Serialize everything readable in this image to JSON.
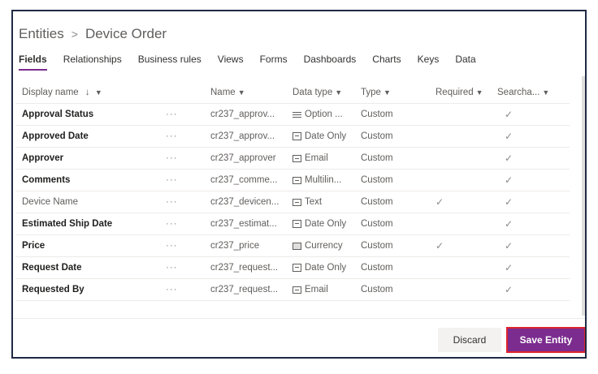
{
  "breadcrumb": {
    "root": "Entities",
    "separator": ">",
    "current": "Device Order"
  },
  "tabs": [
    "Fields",
    "Relationships",
    "Business rules",
    "Views",
    "Forms",
    "Dashboards",
    "Charts",
    "Keys",
    "Data"
  ],
  "active_tab": "Fields",
  "columns": {
    "display_name": "Display name",
    "sort_arrow": "↓",
    "name": "Name",
    "data_type": "Data type",
    "type": "Type",
    "required": "Required",
    "searchable": "Searcha..."
  },
  "rows": [
    {
      "display": "Approval Status",
      "bold": true,
      "more": "···",
      "name": "cr237_approv...",
      "dtype_icon": "option-set-icon",
      "dtype": "Option ...",
      "type": "Custom",
      "required": "",
      "searchable": "✓"
    },
    {
      "display": "Approved Date",
      "bold": true,
      "more": "···",
      "name": "cr237_approv...",
      "dtype_icon": "date-icon",
      "dtype": "Date Only",
      "type": "Custom",
      "required": "",
      "searchable": "✓"
    },
    {
      "display": "Approver",
      "bold": true,
      "more": "···",
      "name": "cr237_approver",
      "dtype_icon": "email-icon",
      "dtype": "Email",
      "type": "Custom",
      "required": "",
      "searchable": "✓"
    },
    {
      "display": "Comments",
      "bold": true,
      "more": "···",
      "name": "cr237_comme...",
      "dtype_icon": "multiline-icon",
      "dtype": "Multilin...",
      "type": "Custom",
      "required": "",
      "searchable": "✓"
    },
    {
      "display": "Device Name",
      "bold": false,
      "more": "···",
      "name": "cr237_devicen...",
      "dtype_icon": "text-icon",
      "dtype": "Text",
      "type": "Custom",
      "required": "✓",
      "searchable": "✓"
    },
    {
      "display": "Estimated Ship Date",
      "bold": true,
      "more": "···",
      "name": "cr237_estimat...",
      "dtype_icon": "date-icon",
      "dtype": "Date Only",
      "type": "Custom",
      "required": "",
      "searchable": "✓"
    },
    {
      "display": "Price",
      "bold": true,
      "more": "···",
      "name": "cr237_price",
      "dtype_icon": "currency-icon",
      "dtype": "Currency",
      "type": "Custom",
      "required": "✓",
      "searchable": "✓"
    },
    {
      "display": "Request Date",
      "bold": true,
      "more": "···",
      "name": "cr237_request...",
      "dtype_icon": "date-icon",
      "dtype": "Date Only",
      "type": "Custom",
      "required": "",
      "searchable": "✓"
    },
    {
      "display": "Requested By",
      "bold": true,
      "more": "···",
      "name": "cr237_request...",
      "dtype_icon": "email-icon",
      "dtype": "Email",
      "type": "Custom",
      "required": "",
      "searchable": "✓"
    }
  ],
  "buttons": {
    "discard": "Discard",
    "save": "Save Entity"
  },
  "colors": {
    "accent": "#7b2c8e",
    "highlight_border": "#e0242e"
  }
}
